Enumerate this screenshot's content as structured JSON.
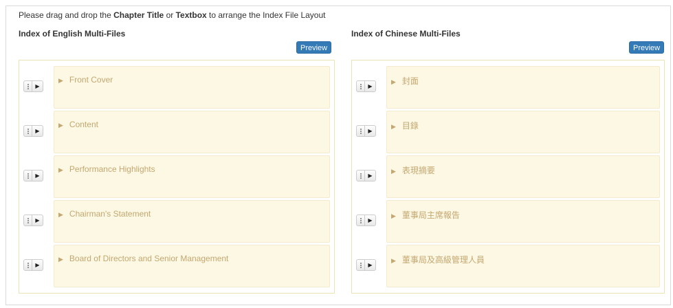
{
  "instruction": {
    "prefix": "Please drag and drop the ",
    "term1": "Chapter Title",
    "mid": " or ",
    "term2": "Textbox",
    "suffix": " to arrange the Index File Layout"
  },
  "english": {
    "title": "Index of English Multi-Files",
    "preview_label": "Preview",
    "items": [
      {
        "label": "Front Cover"
      },
      {
        "label": "Content"
      },
      {
        "label": "Performance Highlights"
      },
      {
        "label": "Chairman's Statement"
      },
      {
        "label": "Board of Directors and Senior Management"
      }
    ]
  },
  "chinese": {
    "title": "Index of Chinese Multi-Files",
    "preview_label": "Preview",
    "items": [
      {
        "label": "封面"
      },
      {
        "label": "目錄"
      },
      {
        "label": "表現摘要"
      },
      {
        "label": "董事局主席報告"
      },
      {
        "label": "董事局及高級管理人員"
      }
    ]
  },
  "icons": {
    "expand": "▶",
    "handle_play": "▶"
  },
  "colors": {
    "accent": "#337ab7",
    "card_bg": "#fcf8e3",
    "card_text": "#c4a771",
    "panel_border": "#ece3b4"
  }
}
